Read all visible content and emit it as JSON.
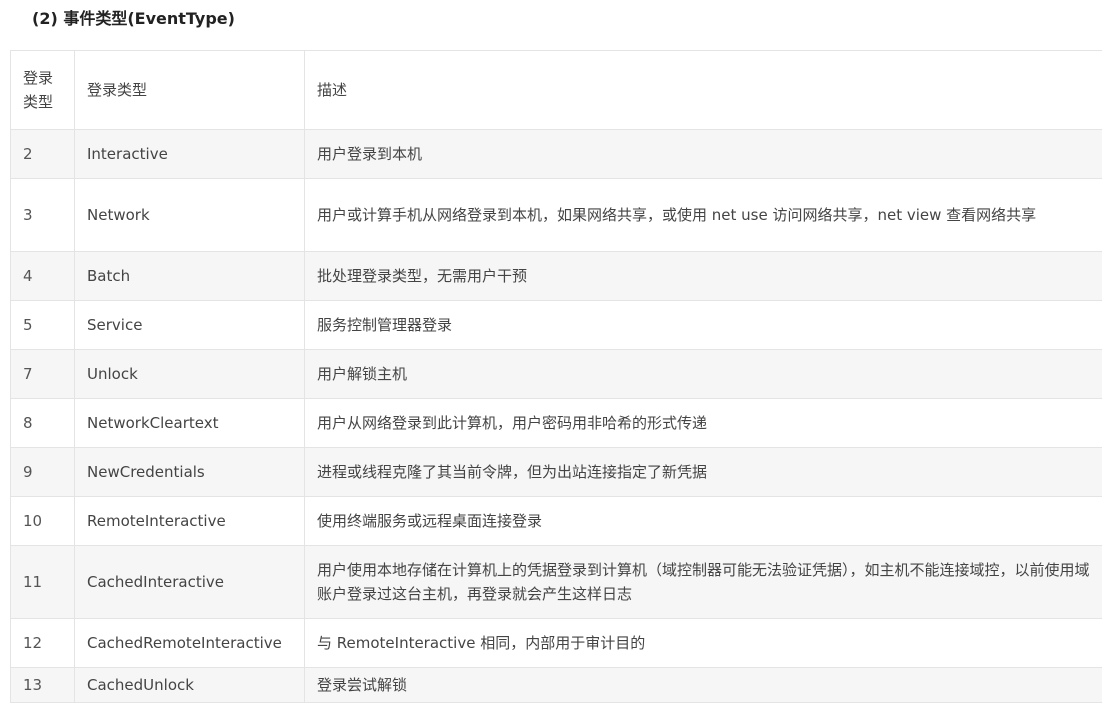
{
  "heading": "(2) 事件类型(EventType)",
  "table": {
    "headers": [
      "登录类型",
      "登录类型",
      "描述"
    ],
    "header_first_lines": [
      "登录",
      "类型"
    ],
    "rows": [
      {
        "type": "2",
        "name": "Interactive",
        "desc": "用户登录到本机"
      },
      {
        "type": "3",
        "name": "Network",
        "desc": "用户或计算手机从网络登录到本机，如果网络共享，或使用 net use 访问网络共享，net view 查看网络共享"
      },
      {
        "type": "4",
        "name": "Batch",
        "desc": "批处理登录类型，无需用户干预"
      },
      {
        "type": "5",
        "name": "Service",
        "desc": "服务控制管理器登录"
      },
      {
        "type": "7",
        "name": "Unlock",
        "desc": "用户解锁主机"
      },
      {
        "type": "8",
        "name": "NetworkCleartext",
        "desc": "用户从网络登录到此计算机，用户密码用非哈希的形式传递"
      },
      {
        "type": "9",
        "name": "NewCredentials",
        "desc": "进程或线程克隆了其当前令牌，但为出站连接指定了新凭据"
      },
      {
        "type": "10",
        "name": "RemoteInteractive",
        "desc": "使用终端服务或远程桌面连接登录"
      },
      {
        "type": "11",
        "name": "CachedInteractive",
        "desc": "用户使用本地存储在计算机上的凭据登录到计算机（域控制器可能无法验证凭据），如主机不能连接域控，以前使用域账户登录过这台主机，再登录就会产生这样日志"
      },
      {
        "type": "12",
        "name": "CachedRemoteInteractive",
        "desc": "与 RemoteInteractive 相同，内部用于审计目的"
      },
      {
        "type": "13",
        "name": "CachedUnlock",
        "desc": "登录尝试解锁"
      }
    ]
  }
}
